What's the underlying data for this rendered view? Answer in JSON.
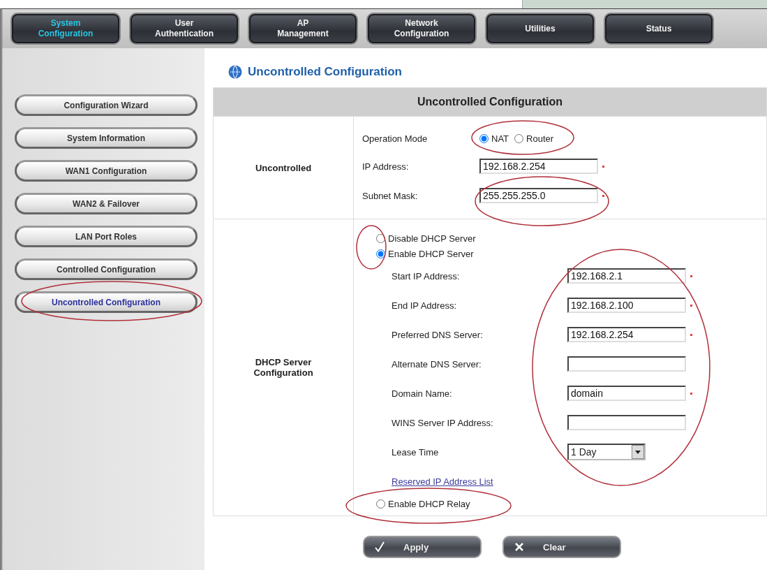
{
  "nav_tabs": [
    {
      "lines": [
        "System",
        "Configuration"
      ],
      "selected": true
    },
    {
      "lines": [
        "User",
        "Authentication"
      ],
      "selected": false
    },
    {
      "lines": [
        "AP",
        "Management"
      ],
      "selected": false
    },
    {
      "lines": [
        "Network",
        "Configuration"
      ],
      "selected": false
    },
    {
      "lines": [
        "Utilities"
      ],
      "selected": false
    },
    {
      "lines": [
        "Status"
      ],
      "selected": false
    }
  ],
  "sidebar": {
    "items": [
      {
        "label": "Configuration Wizard",
        "selected": false
      },
      {
        "label": "System Information",
        "selected": false
      },
      {
        "label": "WAN1 Configuration",
        "selected": false
      },
      {
        "label": "WAN2 & Failover",
        "selected": false
      },
      {
        "label": "LAN Port Roles",
        "selected": false
      },
      {
        "label": "Controlled Configuration",
        "selected": false
      },
      {
        "label": "Uncontrolled Configuration",
        "selected": true
      }
    ]
  },
  "page_title": "Uncontrolled Configuration",
  "panel": {
    "title": "Uncontrolled Configuration",
    "sections": [
      {
        "label": "Uncontrolled",
        "rows": [
          {
            "kind": "radio_group",
            "label": "Operation Mode",
            "options": [
              {
                "label": "NAT",
                "selected": true
              },
              {
                "label": "Router",
                "selected": false
              }
            ]
          },
          {
            "kind": "input",
            "label": "IP Address:",
            "value": "192.168.2.254",
            "required": true
          },
          {
            "kind": "input",
            "label": "Subnet Mask:",
            "value": "255.255.255.0",
            "required": true
          }
        ]
      },
      {
        "label": "DHCP Server Configuration",
        "rows": [
          {
            "kind": "radio",
            "label": "Disable DHCP Server",
            "selected": false
          },
          {
            "kind": "radio",
            "label": "Enable DHCP Server",
            "selected": true
          },
          {
            "kind": "sub_input",
            "label": "Start IP Address:",
            "value": "192.168.2.1",
            "required": true
          },
          {
            "kind": "sub_input",
            "label": "End IP Address:",
            "value": "192.168.2.100",
            "required": true
          },
          {
            "kind": "sub_input",
            "label": "Preferred DNS Server:",
            "value": "192.168.2.254",
            "required": true
          },
          {
            "kind": "sub_input",
            "label": "Alternate DNS Server:",
            "required": false
          },
          {
            "kind": "sub_input",
            "label": "Domain Name:",
            "value": "domain",
            "required": true
          },
          {
            "kind": "sub_input",
            "label": "WINS Server IP Address:",
            "required": false
          },
          {
            "kind": "sub_select",
            "label": "Lease Time",
            "value": "1 Day"
          },
          {
            "kind": "link",
            "label": "Reserved IP Address List"
          },
          {
            "kind": "radio",
            "label": "Enable DHCP Relay",
            "selected": false
          }
        ]
      }
    ]
  },
  "buttons": [
    {
      "kind": "apply",
      "label": "Apply"
    },
    {
      "kind": "clear",
      "label": "Clear"
    }
  ]
}
